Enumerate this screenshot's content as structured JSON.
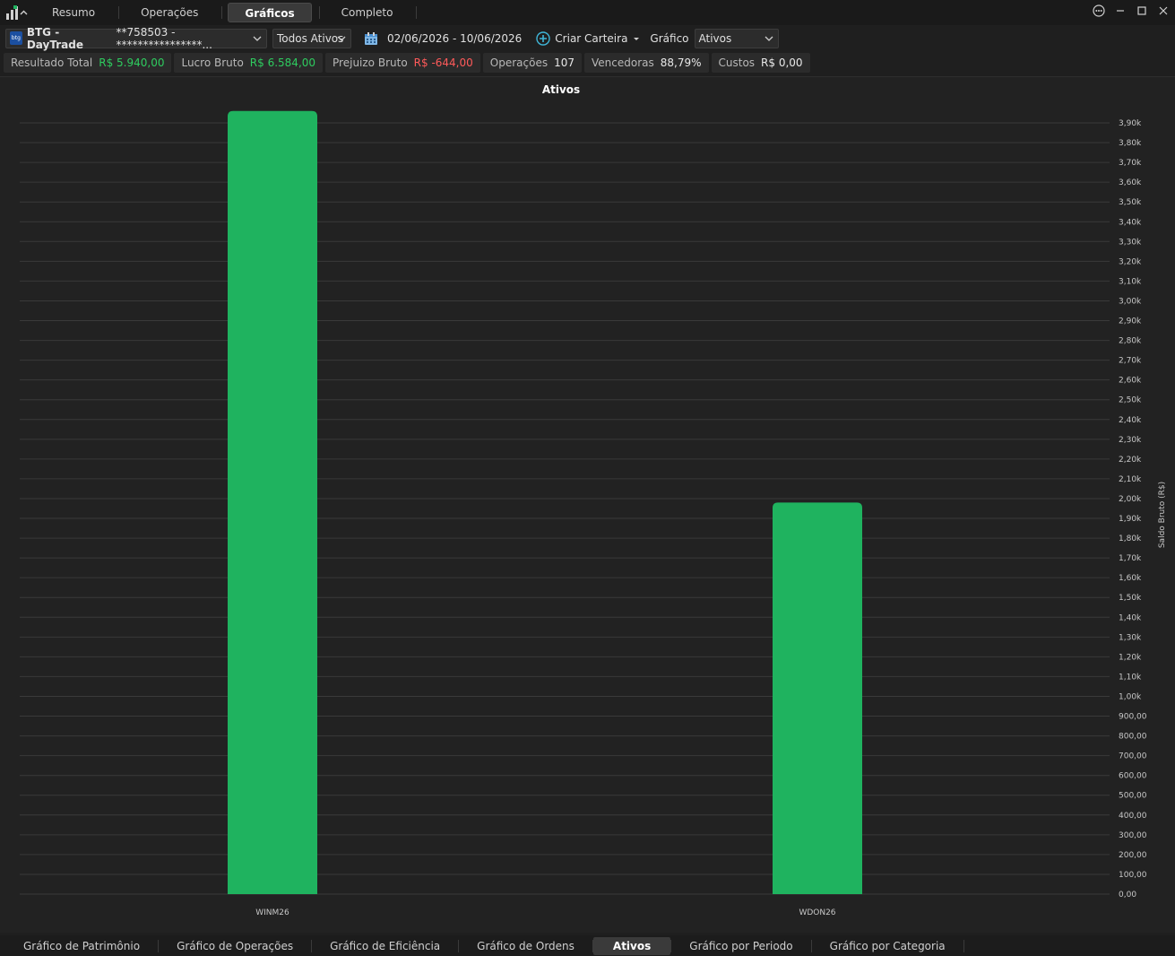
{
  "header": {
    "tabs": [
      {
        "label": "Resumo",
        "active": false
      },
      {
        "label": "Operações",
        "active": false
      },
      {
        "label": "Gráficos",
        "active": true
      },
      {
        "label": "Completo",
        "active": false
      }
    ]
  },
  "toolbar": {
    "account": "BTG - DayTrade",
    "account_number": "**758503 - ****************...",
    "broker_badge": "btg",
    "asset_filter": "Todos Ativos",
    "date_range": "02/06/2026 - 10/06/2026",
    "create_wallet": "Criar Carteira",
    "chart_label": "Gráfico",
    "chart_select": "Ativos"
  },
  "stats": [
    {
      "label": "Resultado Total",
      "value": "R$ 5.940,00",
      "tone": "pos"
    },
    {
      "label": "Lucro Bruto",
      "value": "R$ 6.584,00",
      "tone": "pos"
    },
    {
      "label": "Prejuizo Bruto",
      "value": "R$ -644,00",
      "tone": "neg"
    },
    {
      "label": "Operações",
      "value": "107",
      "tone": "neutral"
    },
    {
      "label": "Vencedoras",
      "value": "88,79%",
      "tone": "neutral"
    },
    {
      "label": "Custos",
      "value": "R$ 0,00",
      "tone": "neutral"
    }
  ],
  "colors": {
    "bar": "#1fb35f",
    "grid": "#3a3a3a",
    "panel_bg": "#222222",
    "axis_text": "#c8c8c8"
  },
  "chart_data": {
    "type": "bar",
    "title": "Ativos",
    "ylabel": "Saldo Bruto (R$)",
    "categories": [
      "WINM26",
      "WDON26"
    ],
    "values": [
      3960,
      1980
    ],
    "ylim": [
      0,
      3900
    ],
    "ytick_step": 100,
    "ytick_labels": [
      "0,00",
      "100,00",
      "200,00",
      "300,00",
      "400,00",
      "500,00",
      "600,00",
      "700,00",
      "800,00",
      "900,00",
      "1,00k",
      "1,10k",
      "1,20k",
      "1,30k",
      "1,40k",
      "1,50k",
      "1,60k",
      "1,70k",
      "1,80k",
      "1,90k",
      "2,00k",
      "2,10k",
      "2,20k",
      "2,30k",
      "2,40k",
      "2,50k",
      "2,60k",
      "2,70k",
      "2,80k",
      "2,90k",
      "3,00k",
      "3,10k",
      "3,20k",
      "3,30k",
      "3,40k",
      "3,50k",
      "3,60k",
      "3,70k",
      "3,80k",
      "3,90k"
    ],
    "axis_position": "right",
    "grid": true
  },
  "bottom_tabs": [
    {
      "label": "Gráfico de Patrimônio",
      "active": false
    },
    {
      "label": "Gráfico de Operações",
      "active": false
    },
    {
      "label": "Gráfico de Eficiência",
      "active": false
    },
    {
      "label": "Gráfico de Ordens",
      "active": false
    },
    {
      "label": "Ativos",
      "active": true
    },
    {
      "label": "Gráfico por Periodo",
      "active": false
    },
    {
      "label": "Gráfico por Categoria",
      "active": false
    }
  ]
}
